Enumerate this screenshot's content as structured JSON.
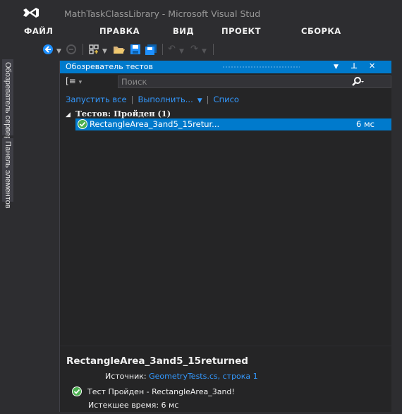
{
  "window": {
    "title": "MathTaskClassLibrary - Microsoft Visual Stud"
  },
  "menu": [
    "ФАЙЛ",
    "ПРАВКА",
    "ВИД",
    "ПРОЕКТ",
    "СБОРКА"
  ],
  "toolbar": {
    "icons": [
      "back-arrow-icon",
      "dropdown-icon",
      "forward-arrow-icon",
      "new-project-icon",
      "open-folder-icon",
      "save-icon",
      "save-all-icon",
      "undo-icon",
      "redo-icon"
    ]
  },
  "side_tabs": {
    "server_explorer": "Обозреватель серверов",
    "toolbox": "Панель элементов"
  },
  "test_explorer": {
    "title": "Обозреватель тестов",
    "search_placeholder": "Поиск",
    "run_all": "Запустить все",
    "run": "Выполнить...",
    "playlist": "Списо",
    "group_label": "Тестов: Пройден",
    "group_count": "(1)",
    "tests": [
      {
        "name": "RectangleArea_3and5_15retur...",
        "time": "6 мс",
        "status": "passed"
      }
    ],
    "details": {
      "test_name": "RectangleArea_3and5_15returned",
      "source_label": "Источник:",
      "source_value": "GeometryTests.cs, строка 1",
      "result_text": "Тест Пройден - RectangleArea_3and!",
      "elapsed_label": "Истекшее время: 6 мс"
    }
  },
  "colors": {
    "accent": "#007acc",
    "link": "#3399ff",
    "pass": "#4caf50",
    "background": "#2d2d30",
    "panel": "#252526"
  }
}
